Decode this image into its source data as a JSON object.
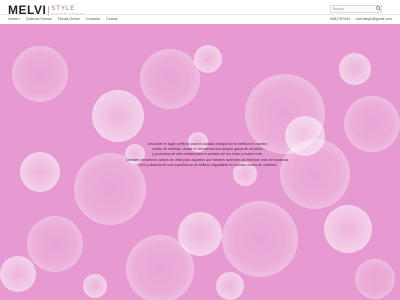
{
  "header": {
    "logo": {
      "main": "MELVI",
      "sub1": "STYLE",
      "sub2": "centro de estetica"
    },
    "search": {
      "placeholder": "Buscar"
    }
  },
  "nav": {
    "items": [
      "Home",
      "Quienes Somos",
      "Tienda Online",
      "Contacto",
      "Cursos"
    ]
  },
  "contact": {
    "phone": "6481757944",
    "email": "melvistyle@gmail.com"
  },
  "hero": {
    "lines": [
      "Descubre el lugar perfecto para el cuidado integral de tu belleza en nuestro",
      "centro de estética, donde te ofrecemos una amplia gama de servicios",
      "y productos de alta calidad para el cuidado de tus uñas y mucho más.",
      "También ofrecemos cursos de uñas para aquellos que deseen aprender las técnicas más innovadoras.",
      "¡Ven y disfruta de una experiencia de belleza inigualable en nuestro centro de estética!"
    ]
  },
  "colors": {
    "background": "#e79ad1",
    "bubble": "#ffffff",
    "text": "#4b2a45"
  }
}
